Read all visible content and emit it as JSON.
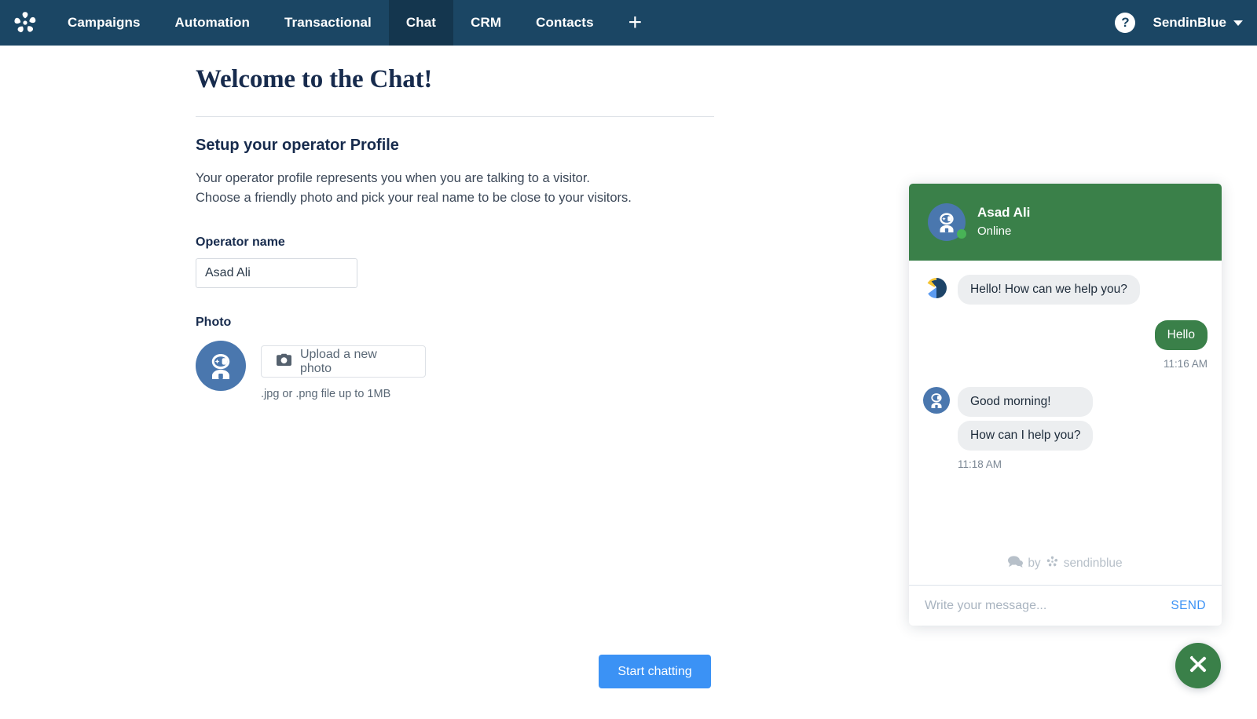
{
  "navbar": {
    "logo_icon": "sendinblue-logo-icon",
    "items": [
      {
        "label": "Campaigns",
        "active": false
      },
      {
        "label": "Automation",
        "active": false
      },
      {
        "label": "Transactional",
        "active": false
      },
      {
        "label": "Chat",
        "active": true
      },
      {
        "label": "CRM",
        "active": false
      },
      {
        "label": "Contacts",
        "active": false
      }
    ],
    "add_label": "+",
    "help_icon": "question-mark-icon",
    "help_label": "?",
    "account_name": "SendinBlue",
    "caret_icon": "chevron-down-icon"
  },
  "main": {
    "page_title": "Welcome to the Chat!",
    "section_title": "Setup your operator Profile",
    "description_line1": "Your operator profile represents you when you are talking to a visitor.",
    "description_line2": "Choose a friendly photo and pick your real name to be close to your visitors.",
    "operator_name_label": "Operator name",
    "operator_name_value": "Asad Ali",
    "operator_name_placeholder": "Operator name",
    "photo_label": "Photo",
    "avatar_icon": "operator-astronaut-avatar-icon",
    "upload_icon": "camera-icon",
    "upload_button_label": "Upload a new photo",
    "upload_hint": ".jpg or .png file up to 1MB",
    "start_button_label": "Start chatting"
  },
  "chat_widget": {
    "header": {
      "avatar_icon": "operator-astronaut-avatar-icon",
      "name": "Asad Ali",
      "status": "Online",
      "status_dot_color": "#48b356"
    },
    "messages": [
      {
        "id": "m1",
        "direction": "in",
        "avatar_icon": "brand-logo-icon",
        "texts": [
          "Hello! How can we help you?"
        ],
        "time": ""
      },
      {
        "id": "m2",
        "direction": "out",
        "avatar_icon": "",
        "texts": [
          "Hello"
        ],
        "time": "11:16 AM"
      },
      {
        "id": "m3",
        "direction": "in",
        "avatar_icon": "operator-astronaut-avatar-icon",
        "texts": [
          "Good morning!",
          "How can I help you?"
        ],
        "time": "11:18 AM"
      }
    ],
    "branding": {
      "chat_icon": "chat-bubbles-icon",
      "by_label": "by",
      "brand_icon": "sendinblue-logo-icon",
      "brand_label": "sendinblue"
    },
    "input_placeholder": "Write your message...",
    "send_label": "SEND"
  },
  "fab": {
    "close_icon": "close-x-icon",
    "color": "#3a8049"
  },
  "colors": {
    "navbar_bg": "#1b4664",
    "navbar_active_bg": "#14364e",
    "accent_blue": "#3b92f5",
    "chat_green": "#3a8049",
    "avatar_blue": "#4a77ae",
    "bubble_gray": "#eceef0"
  }
}
